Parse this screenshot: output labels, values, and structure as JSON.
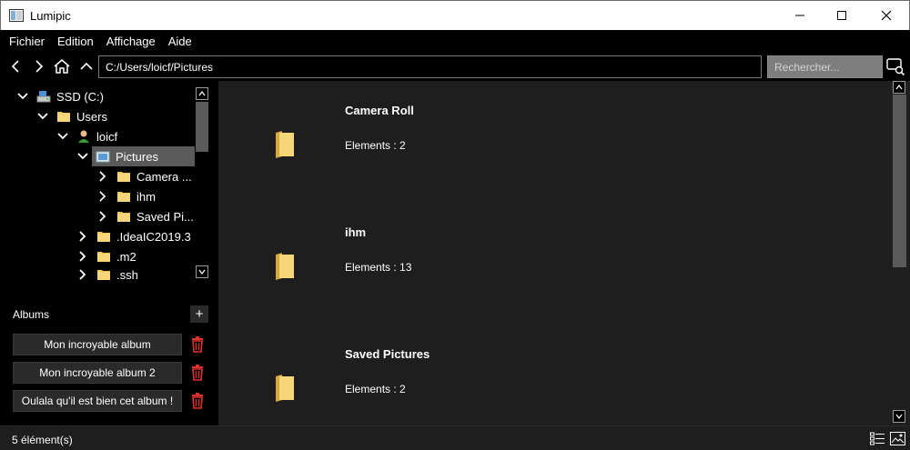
{
  "window": {
    "title": "Lumipic",
    "controls": [
      "minimize-icon",
      "maximize-icon",
      "close-icon"
    ]
  },
  "menu": {
    "items": [
      "Fichier",
      "Edition",
      "Affichage",
      "Aide"
    ]
  },
  "toolbar": {
    "path_value": "C:/Users/loicf/Pictures",
    "search_placeholder": "Rechercher..."
  },
  "tree": {
    "drive": "SSD (C:)",
    "users": "Users",
    "user": "loicf",
    "pictures": "Pictures",
    "camera_roll": "Camera ...",
    "ihm": "ihm",
    "saved_pictures": "Saved Pi...",
    "idea": ".IdeaIC2019.3",
    "m2": ".m2",
    "ssh": ".ssh"
  },
  "albums": {
    "header": "Albums",
    "add_label": "+",
    "items": [
      "Mon incroyable album",
      "Mon incroyable album 2",
      "Oulala qu'il est bien cet album !"
    ]
  },
  "folders": [
    {
      "name": "Camera Roll",
      "count_label": "Elements : 2"
    },
    {
      "name": "ihm",
      "count_label": "Elements : 13"
    },
    {
      "name": "Saved Pictures",
      "count_label": "Elements : 2"
    }
  ],
  "status": {
    "text": "5 élément(s)"
  },
  "colors": {
    "accent_folder": "#f3c85a",
    "trash": "#e0302c",
    "selection": "#5a5a5a",
    "content_bg": "#1e1e1e"
  }
}
